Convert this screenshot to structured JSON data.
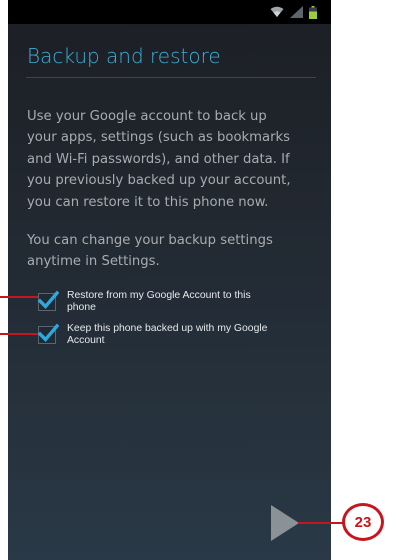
{
  "screen": {
    "title": "Backup and restore",
    "description_lines": [
      "Use your Google account to back up",
      "your apps, settings (such as bookmarks",
      "and Wi-Fi passwords), and other data. If",
      "you previously backed up your account,",
      "you can restore it to this phone now."
    ],
    "note_lines": [
      "You can change your backup settings",
      "anytime in Settings."
    ],
    "options": [
      {
        "label_lines": [
          "Restore from my Google Account to this",
          "phone"
        ],
        "checked": true
      },
      {
        "label_lines": [
          "Keep this phone backed up with my Google",
          "Account"
        ],
        "checked": true
      }
    ]
  },
  "status_bar": {
    "icons": [
      "wifi-icon",
      "signal-icon",
      "battery-icon"
    ]
  },
  "next_button": {
    "icon": "next-arrow-icon"
  },
  "callout": {
    "step_number": "23"
  },
  "colors": {
    "title": "#3dafd8",
    "body_text": "#a8acb0",
    "checkbox_check": "#2fa8de",
    "callout": "#c4161c",
    "battery": "#9ccc3c"
  }
}
